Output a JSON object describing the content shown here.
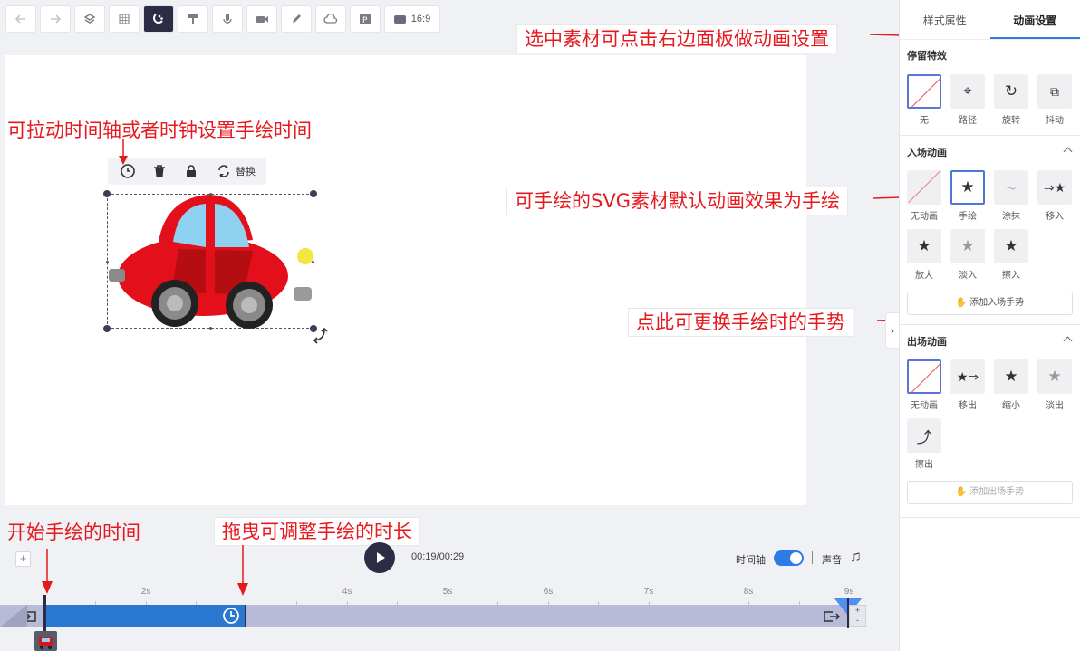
{
  "toolbar": {
    "buttons": [
      {
        "icon": "undo-icon"
      },
      {
        "icon": "redo-icon"
      },
      {
        "icon": "layers-icon"
      },
      {
        "icon": "grid-icon"
      },
      {
        "icon": "magnet-icon"
      },
      {
        "icon": "paint-roller-icon"
      },
      {
        "icon": "microphone-icon"
      },
      {
        "icon": "camera-icon"
      },
      {
        "icon": "pen-icon"
      },
      {
        "icon": "cloud-icon"
      },
      {
        "icon": "p-icon"
      }
    ],
    "ratio_label": "16:9"
  },
  "selection_toolbar": {
    "replace_label": "替换"
  },
  "annotations": {
    "drag_timeline": "可拉动时间轴或者时钟设置手绘时间",
    "select_material": "选中素材可点击右边面板做动画设置",
    "svg_default": "可手绘的SVG素材默认动画效果为手绘",
    "change_gesture": "点此可更换手绘时的手势",
    "start_time": "开始手绘的时间",
    "drag_duration": "拖曳可调整手绘的时长"
  },
  "panel": {
    "tabs": [
      "样式属性",
      "动画设置"
    ],
    "active_tab": 1,
    "stay_effects": {
      "title": "停留特效",
      "items": [
        "无",
        "路径",
        "旋转",
        "抖动"
      ]
    },
    "enter_animation": {
      "title": "入场动画",
      "items": [
        "无动画",
        "手绘",
        "涂抹",
        "移入",
        "放大",
        "淡入",
        "擦入"
      ],
      "add_button": "添加入场手势"
    },
    "exit_animation": {
      "title": "出场动画",
      "items": [
        "无动画",
        "移出",
        "缩小",
        "淡出",
        "擦出"
      ],
      "add_button": "添加出场手势"
    }
  },
  "timeline": {
    "time": "00:19/00:29",
    "timeline_label": "时间轴",
    "timeline_enabled": true,
    "sound_label": "声音",
    "ticks": [
      "2s",
      "4s",
      "5s",
      "6s",
      "7s",
      "8s",
      "9s"
    ],
    "zoom_plus": "+",
    "zoom_minus": "-"
  },
  "colors": {
    "accent": "#2f7be5",
    "annotation": "#e6191f",
    "track": "#b8bbd8",
    "track_active": "#2a78d2"
  }
}
